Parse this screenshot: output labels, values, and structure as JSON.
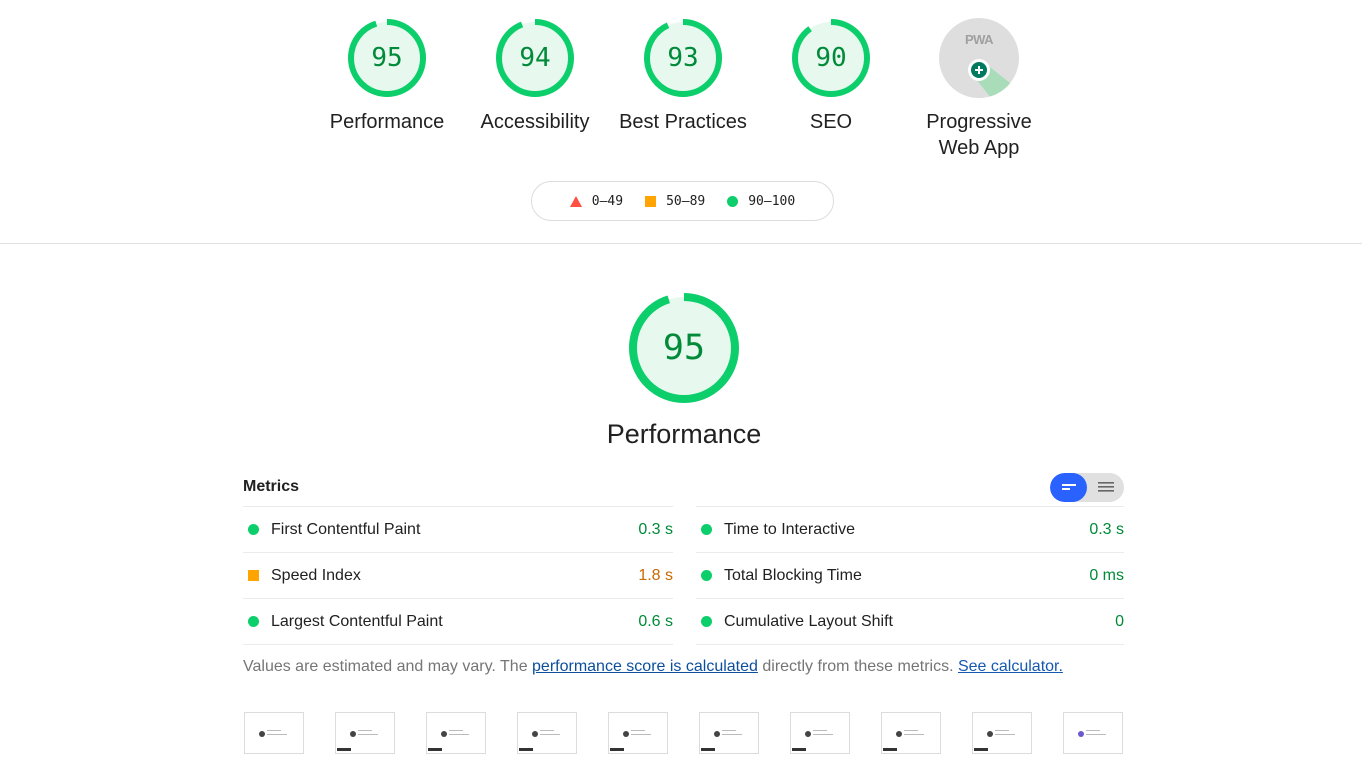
{
  "summary_gauges": [
    {
      "score": "95",
      "label": "Performance",
      "value": 95
    },
    {
      "score": "94",
      "label": "Accessibility",
      "value": 94
    },
    {
      "score": "93",
      "label": "Best Practices",
      "value": 93
    },
    {
      "score": "90",
      "label": "SEO",
      "value": 90
    }
  ],
  "pwa": {
    "badge": "PWA",
    "label_line1": "Progressive",
    "label_line2": "Web App"
  },
  "legend": [
    {
      "range": "0–49",
      "shape": "triangle",
      "color": "#ff4e42"
    },
    {
      "range": "50–89",
      "shape": "square",
      "color": "#ffa400"
    },
    {
      "range": "90–100",
      "shape": "circle",
      "color": "#0cce6b"
    }
  ],
  "performance": {
    "score": "95",
    "value": 95,
    "label": "Performance"
  },
  "metrics": {
    "title": "Metrics",
    "left": [
      {
        "name": "First Contentful Paint",
        "value": "0.3 s",
        "status": "pass"
      },
      {
        "name": "Speed Index",
        "value": "1.8 s",
        "status": "average"
      },
      {
        "name": "Largest Contentful Paint",
        "value": "0.6 s",
        "status": "pass"
      }
    ],
    "right": [
      {
        "name": "Time to Interactive",
        "value": "0.3 s",
        "status": "pass"
      },
      {
        "name": "Total Blocking Time",
        "value": "0 ms",
        "status": "pass"
      },
      {
        "name": "Cumulative Layout Shift",
        "value": "0",
        "status": "pass"
      }
    ]
  },
  "note": {
    "text1": "Values are estimated and may vary. The ",
    "link1": "performance score is calculated",
    "text2": " directly from these metrics. ",
    "link2": "See calculator."
  },
  "colors": {
    "pass": "#0cce6b",
    "pass_text": "#008a39",
    "average": "#ffa400",
    "fail": "#ff4e42",
    "toggle_active": "#2962ff"
  }
}
